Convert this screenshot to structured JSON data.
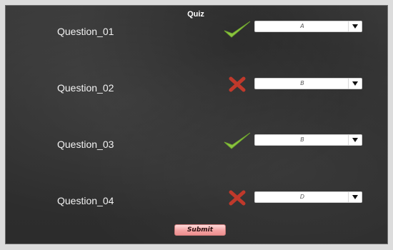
{
  "quiz": {
    "title": "Quiz",
    "submit_label": "Submit",
    "questions": [
      {
        "label": "Question_01",
        "status": "correct",
        "answer": "A"
      },
      {
        "label": "Question_02",
        "status": "incorrect",
        "answer": "B"
      },
      {
        "label": "Question_03",
        "status": "correct",
        "answer": "B"
      },
      {
        "label": "Question_04",
        "status": "incorrect",
        "answer": "D"
      }
    ]
  },
  "colors": {
    "correct_mark": "#8cc63f",
    "incorrect_mark": "#c0392b",
    "submit_button": "#f4a3a3"
  },
  "icons": {
    "correct": "checkmark-icon",
    "incorrect": "cross-icon",
    "dropdown": "chevron-down-icon"
  }
}
